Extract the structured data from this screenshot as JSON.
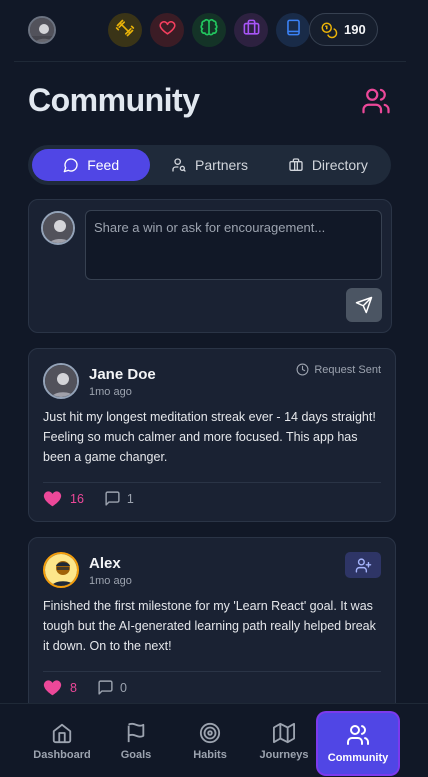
{
  "topbar": {
    "coins": "190",
    "icons": [
      "dumbbell-icon",
      "heart-icon",
      "brain-icon",
      "briefcase-icon",
      "book-icon"
    ],
    "colors": {
      "dumbbell": "#eab308",
      "heart": "#ef4444",
      "brain": "#22c55e",
      "briefcase": "#a855f7",
      "book": "#3b82f6"
    }
  },
  "header": {
    "title": "Community"
  },
  "tabs": [
    {
      "label": "Feed",
      "active": true
    },
    {
      "label": "Partners",
      "active": false
    },
    {
      "label": "Directory",
      "active": false
    }
  ],
  "compose": {
    "placeholder": "Share a win or ask for encouragement..."
  },
  "posts": [
    {
      "name": "Jane Doe",
      "time": "1mo ago",
      "status": "Request Sent",
      "body": "Just hit my longest meditation streak ever - 14 days straight! Feeling so much calmer and more focused. This app has been a game changer.",
      "likes": "16",
      "comments": "1",
      "liked": true
    },
    {
      "name": "Alex",
      "time": "1mo ago",
      "body": "Finished the first milestone for my 'Learn React' goal. It was tough but the AI-generated learning path really helped break it down. On to the next!",
      "likes": "8",
      "comments": "0",
      "liked": true
    }
  ],
  "nav": [
    {
      "label": "Dashboard",
      "active": false
    },
    {
      "label": "Goals",
      "active": false
    },
    {
      "label": "Habits",
      "active": false
    },
    {
      "label": "Journeys",
      "active": false
    },
    {
      "label": "Community",
      "active": true
    }
  ],
  "accent": "#5046e5",
  "like_color": "#ec4899"
}
